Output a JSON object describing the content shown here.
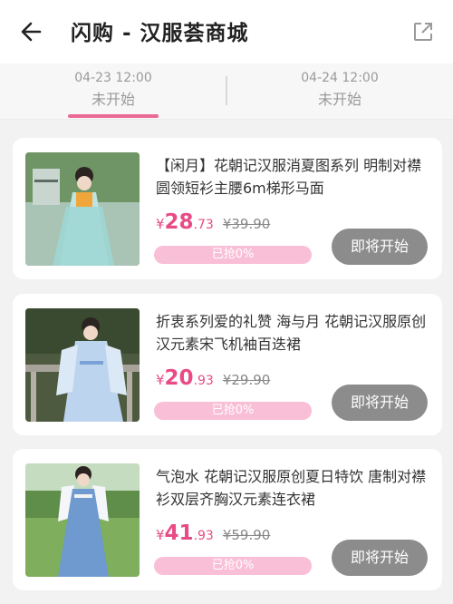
{
  "header": {
    "title": "闪购 - 汉服荟商城",
    "back_icon": "back-arrow-icon",
    "share_icon": "external-link-icon"
  },
  "tabs": [
    {
      "time": "04-23 12:00",
      "status": "未开始",
      "active": true
    },
    {
      "time": "04-24 12:00",
      "status": "未开始",
      "active": false
    }
  ],
  "colors": {
    "accent": "#e84b85",
    "progress_bg": "#f9bfd6",
    "button_bg": "#8c8c8c"
  },
  "products": [
    {
      "name": "【闲月】花朝记汉服消夏图系列 明制对襟圆领短衫主腰6m梯形马面",
      "currency": "¥",
      "price_int": "28",
      "price_dec": ".73",
      "original_price": "¥39.90",
      "sold_text": "已抢0%",
      "sold_fraction": 0,
      "button_label": "即将开始"
    },
    {
      "name": "折衷系列爱的礼赞 海与月 花朝记汉服原创 汉元素宋飞机袖百迭裙",
      "currency": "¥",
      "price_int": "20",
      "price_dec": ".93",
      "original_price": "¥29.90",
      "sold_text": "已抢0%",
      "sold_fraction": 0,
      "button_label": "即将开始"
    },
    {
      "name": "气泡水 花朝记汉服原创夏日特饮 唐制对襟衫双层齐胸汉元素连衣裙",
      "currency": "¥",
      "price_int": "41",
      "price_dec": ".93",
      "original_price": "¥59.90",
      "sold_text": "已抢0%",
      "sold_fraction": 0,
      "button_label": "即将开始"
    }
  ]
}
